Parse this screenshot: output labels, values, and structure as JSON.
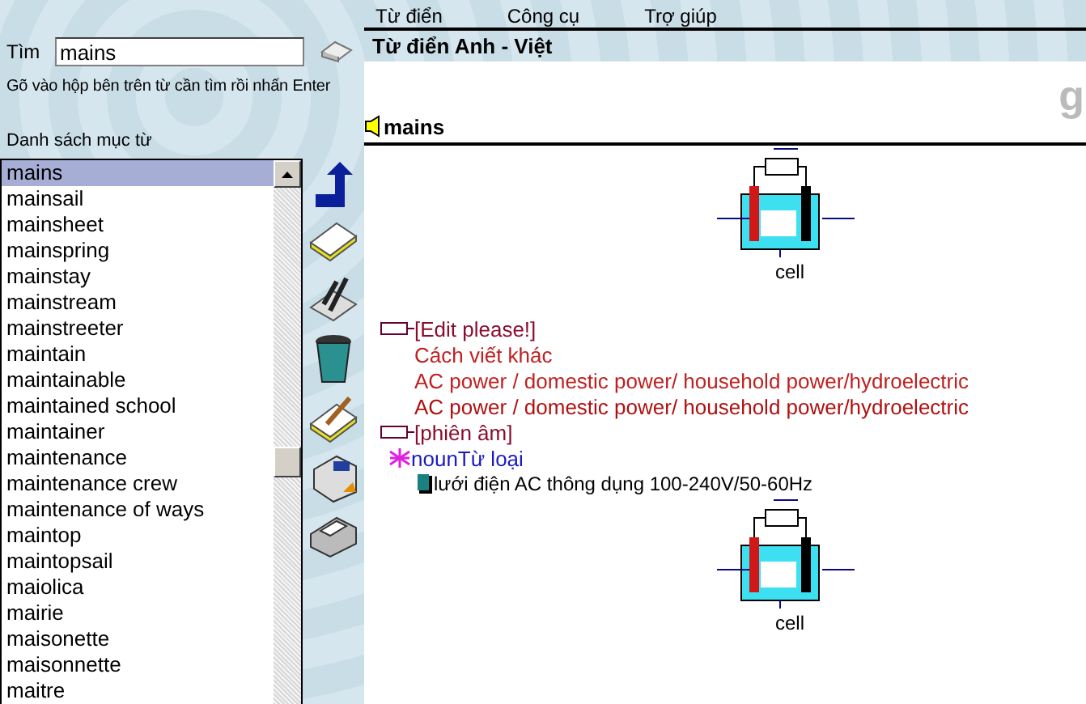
{
  "menu": [
    "Từ điển",
    "Công cụ",
    "Trợ giúp"
  ],
  "search": {
    "label": "Tìm",
    "value": "mains",
    "hint": "Gõ vào hộp bên trên từ cần tìm rồi nhấn Enter"
  },
  "word_list": {
    "title": "Danh sách mục từ",
    "items": [
      {
        "text": "mains",
        "selected": true
      },
      {
        "text": "mainsail",
        "selected": false
      },
      {
        "text": "mainsheet",
        "selected": false
      },
      {
        "text": "mainspring",
        "selected": false
      },
      {
        "text": "mainstay",
        "selected": false
      },
      {
        "text": "mainstream",
        "selected": false
      },
      {
        "text": "mainstreeter",
        "selected": false
      },
      {
        "text": "maintain",
        "selected": false
      },
      {
        "text": "maintainable",
        "selected": false
      },
      {
        "text": "maintained school",
        "selected": false
      },
      {
        "text": "maintainer",
        "selected": false
      },
      {
        "text": "maintenance",
        "selected": false
      },
      {
        "text": "maintenance crew",
        "selected": false
      },
      {
        "text": "maintenance of ways",
        "selected": false
      },
      {
        "text": "maintop",
        "selected": false
      },
      {
        "text": "maintopsail",
        "selected": false
      },
      {
        "text": "maiolica",
        "selected": false
      },
      {
        "text": "mairie",
        "selected": false
      },
      {
        "text": "maisonette",
        "selected": false
      },
      {
        "text": "maisonnette",
        "selected": false
      },
      {
        "text": "maitre",
        "selected": false
      }
    ]
  },
  "dictionary": {
    "title": "Từ điển Anh - Việt",
    "corner_letter": "g",
    "headword": "mains",
    "figure_caption": "cell",
    "entries": [
      {
        "kind": "tag",
        "text": "[Edit please!]"
      },
      {
        "kind": "overlay",
        "under": "AC power / domestic power/ household power/hydroelectric",
        "over": "Cách viết khác"
      },
      {
        "kind": "sense",
        "text": "AC power / domestic power/ household power/hydroelectric"
      },
      {
        "kind": "tag",
        "text": "[phiên âm]"
      },
      {
        "kind": "pos",
        "text": "nounTừ loại"
      },
      {
        "kind": "meaning",
        "text": "lưới điện AC thông dụng 100-240V/50-60Hz"
      },
      {
        "kind": "figure",
        "caption": "cell"
      }
    ]
  }
}
